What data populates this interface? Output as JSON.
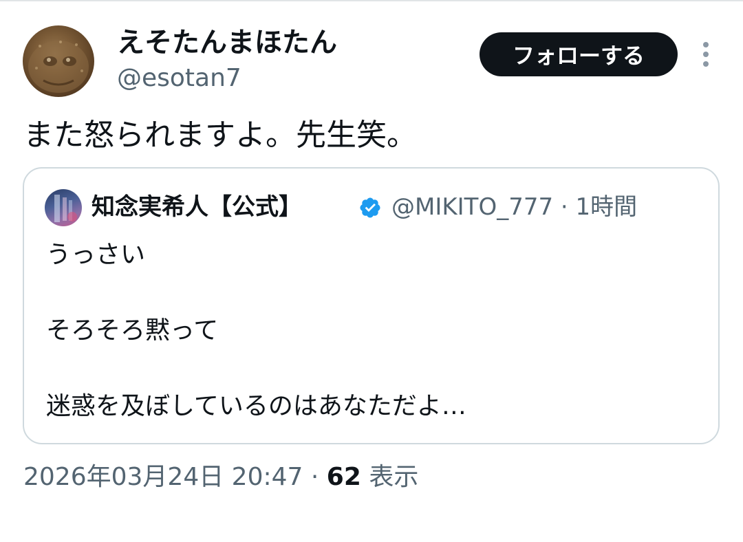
{
  "author": {
    "display_name": "えそたんまほたん",
    "handle": "@esotan7"
  },
  "follow_button_label": "フォローする",
  "more_icon": "more-vertical-icon",
  "tweet_text": "また怒られますよ。先生笑。",
  "quoted_tweet": {
    "display_name": "知念実希人【公式】",
    "verified_icon": "verified-badge-icon",
    "handle_and_time": "@MIKITO_777 · 1時間",
    "lines": [
      "うっさい",
      "そろそろ黙って",
      "迷惑を及ぼしているのはあなただよ…"
    ]
  },
  "footer": {
    "timestamp": "2026年03月24日 20:47",
    "separator": " · ",
    "views_count": "62",
    "views_label": " 表示"
  },
  "colors": {
    "text_primary": "#0f1419",
    "text_secondary": "#536471",
    "border": "#cfd9de",
    "follow_button_bg": "#0f1419",
    "verified_blue": "#1d9bf0"
  }
}
